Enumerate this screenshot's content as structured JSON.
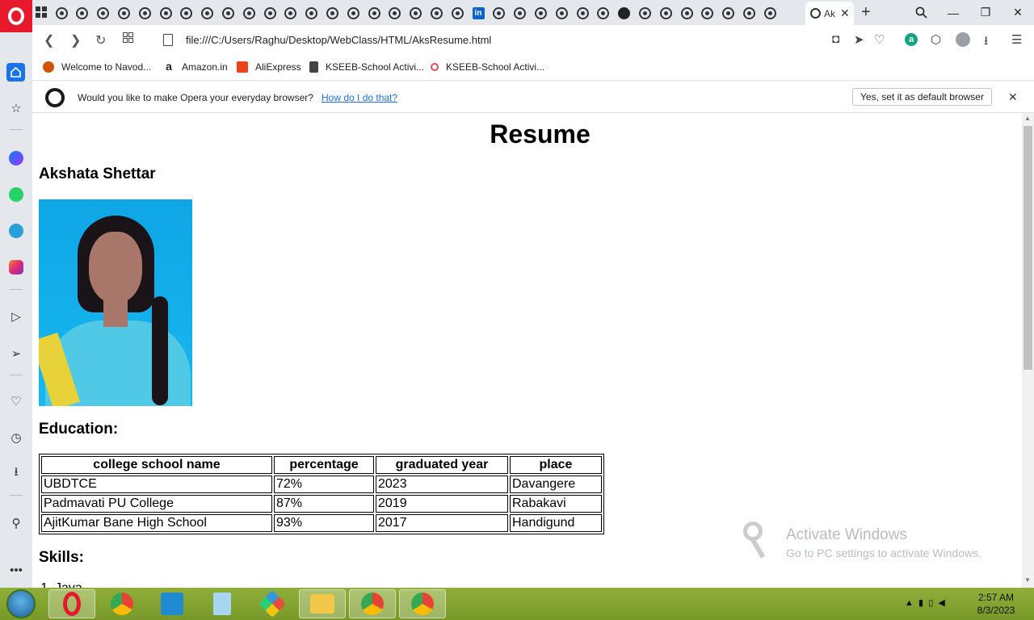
{
  "browser": {
    "active_tab_title": "Ak",
    "url": "file:///C:/Users/Raghu/Desktop/WebClass/HTML/AksResume.html",
    "bookmarks": [
      {
        "label": "Welcome to Navod...",
        "icon": "navodaya-icon",
        "color": "#d35400"
      },
      {
        "label": "Amazon.in",
        "icon": "amazon-icon",
        "color": "#222222"
      },
      {
        "label": "AliExpress",
        "icon": "aliexpress-icon",
        "color": "#e8451b"
      },
      {
        "label": "KSEEB-School Activi...",
        "icon": "document-icon",
        "color": "#444444"
      },
      {
        "label": "KSEEB-School Activi...",
        "icon": "eye-icon",
        "color": "#e05050"
      }
    ],
    "notice": {
      "text": "Would you like to make Opera your everyday browser?",
      "link": "How do I do that?",
      "button": "Yes, set it as default browser"
    }
  },
  "page": {
    "title": "Resume",
    "name": "Akshata Shettar",
    "education_heading": "Education:",
    "table": {
      "headers": [
        "college school name",
        "percentage",
        "graduated year",
        "place"
      ],
      "rows": [
        [
          "UBDTCE",
          "72%",
          "2023",
          "Davangere"
        ],
        [
          "Padmavati PU College",
          "87%",
          "2019",
          "Rabakavi"
        ],
        [
          "AjitKumar Bane High School",
          "93%",
          "2017",
          "Handigund"
        ]
      ]
    },
    "skills_heading": "Skills:",
    "skills": [
      "Java"
    ]
  },
  "watermark": {
    "title": "Activate Windows",
    "subtitle": "Go to PC settings to activate Windows."
  },
  "taskbar": {
    "time": "2:57 AM",
    "date": "8/3/2023"
  },
  "colors": {
    "opera_red": "#e8192c",
    "accent_blue": "#1a73e8",
    "taskbar_green": "#8fae3a"
  }
}
